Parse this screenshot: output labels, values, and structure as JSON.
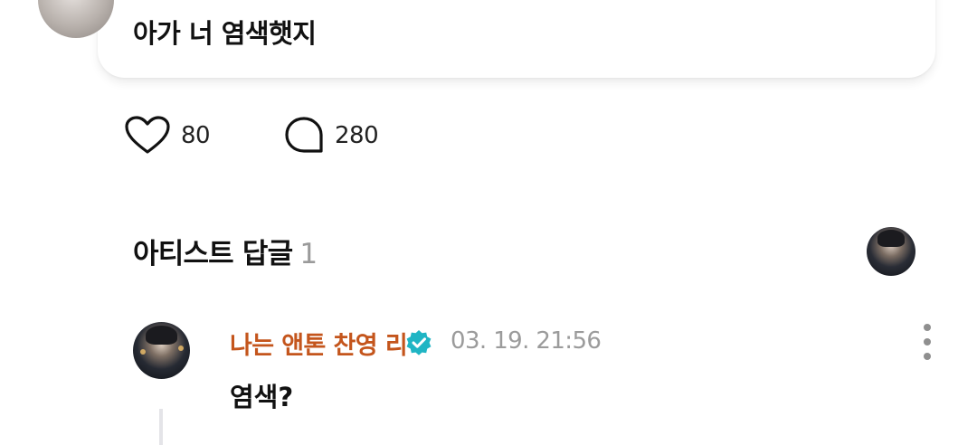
{
  "post": {
    "text": "아가 너 염색햇지"
  },
  "reactions": {
    "likes": "80",
    "comments": "280"
  },
  "artist_replies": {
    "title": "아티스트 답글",
    "count": "1"
  },
  "reply": {
    "author": "나는 앤톤 찬영 리",
    "timestamp": "03. 19. 21:56",
    "text": "염색?"
  },
  "colors": {
    "author_name": "#c4551c",
    "verified_badge": "#1fb5c4",
    "muted_text": "#9b9b9b"
  },
  "icons": [
    "heart-icon",
    "comment-bubble-icon",
    "verified-badge-icon",
    "more-vertical-icon"
  ]
}
